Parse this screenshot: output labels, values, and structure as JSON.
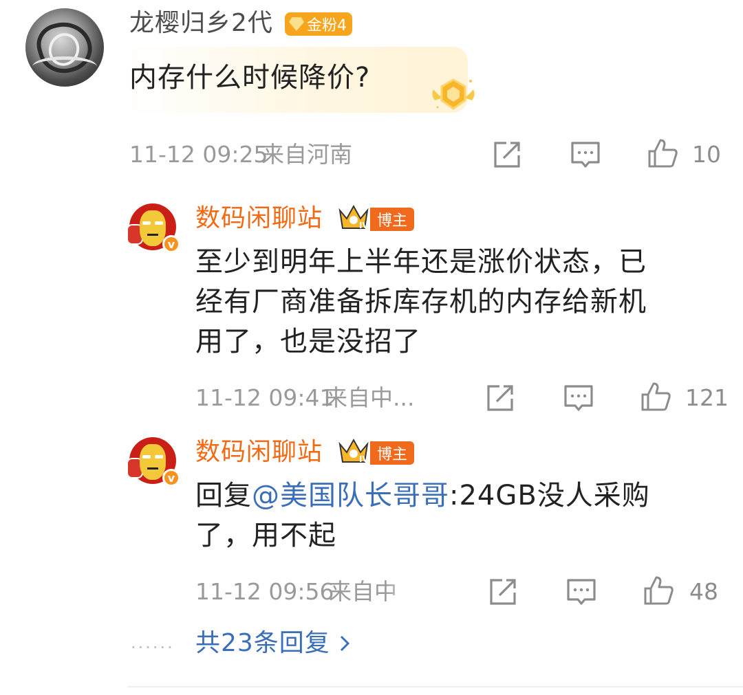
{
  "comment": {
    "username": "龙樱归乡2代",
    "fan_badge": "金粉4",
    "text": "内存什么时候降价?",
    "time": "11-12 09:25",
    "location": "来自河南",
    "likes": "10"
  },
  "replies": [
    {
      "author": "数码闲聊站",
      "badge": "博主",
      "crown_level": "IV",
      "text_lines": [
        "至少到明年上半年还是涨价状态，已",
        "经有厂商准备拆库存机的内存给新机",
        "用了，也是没招了"
      ],
      "time": "11-12 09:41",
      "location": "来自中...",
      "likes": "121"
    },
    {
      "author": "数码闲聊站",
      "badge": "博主",
      "crown_level": "IV",
      "prefix": "回复",
      "mention": "@美国队长哥哥",
      "text_after": ":24GB没人采购",
      "text_line2": "了，用不起",
      "time": "11-12 09:56",
      "location": "来自中",
      "likes": "48"
    }
  ],
  "more_replies": {
    "dots": "······",
    "label": "共23条回复"
  },
  "icons": {
    "share": "share-icon",
    "comment": "comment-icon",
    "like": "thumbs-up-icon",
    "more": "chevron-right-icon"
  },
  "colors": {
    "author_orange": "#f26a13",
    "link_blue": "#3a6fb8",
    "fan_badge_gold": "#f7a51c",
    "meta_gray": "#9a9a9a"
  }
}
